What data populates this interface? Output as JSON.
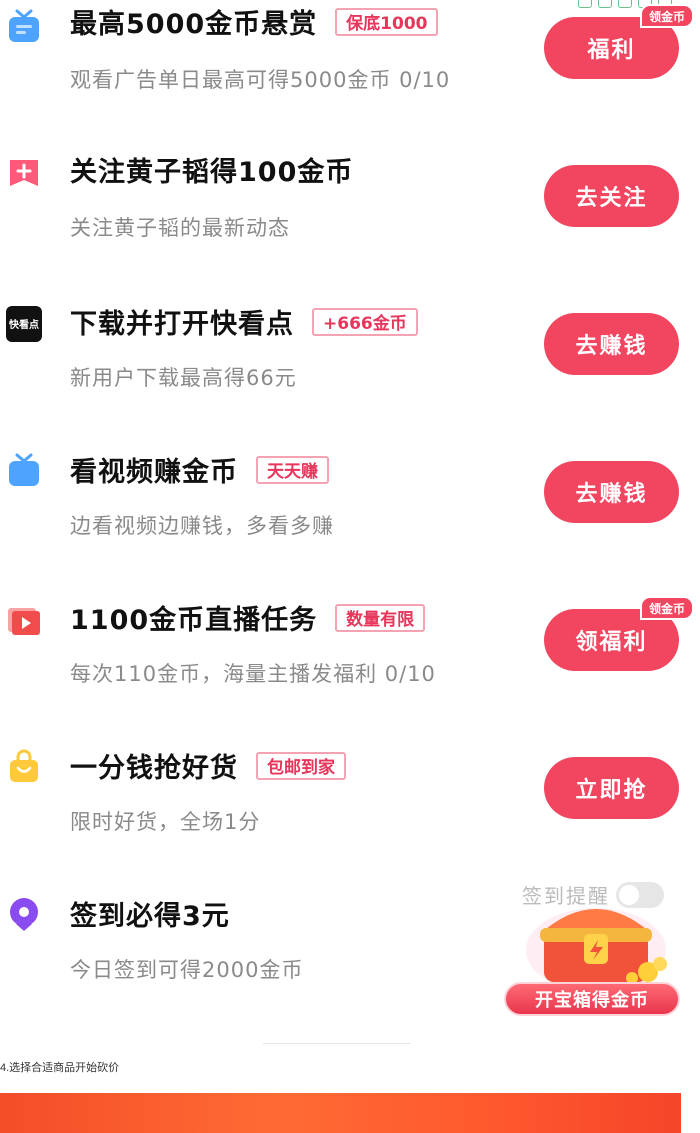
{
  "tasks": [
    {
      "title": "最高5000金币悬赏",
      "tag": "保底1000",
      "subtitle": "观看广告单日最高可得5000金币 0/10",
      "button": "福利",
      "badge": "领金币",
      "icon": "tv-icon",
      "icon_color": "#4da3ff"
    },
    {
      "title": "关注黄子韬得100金币",
      "tag": "",
      "subtitle": "关注黄子韬的最新动态",
      "button": "去关注",
      "badge": "",
      "icon": "plus-bookmark-icon",
      "icon_color": "#ff5a7a"
    },
    {
      "title": "下载并打开快看点",
      "tag": "+666金币",
      "subtitle": "新用户下载最高得66元",
      "button": "去赚钱",
      "badge": "",
      "icon": "kuaikandian-logo-icon",
      "icon_color": "#111111",
      "icon_text": "快看点"
    },
    {
      "title": "看视频赚金币",
      "tag": "天天赚",
      "subtitle": "边看视频边赚钱，多看多赚",
      "button": "去赚钱",
      "badge": "",
      "icon": "tv-icon",
      "icon_color": "#4da3ff"
    },
    {
      "title": "1100金币直播任务",
      "tag": "数量有限",
      "subtitle": "每次110金币，海量主播发福利 0/10",
      "button": "领福利",
      "badge": "领金币",
      "icon": "live-play-icon",
      "icon_color": "#f24b4b"
    },
    {
      "title": "一分钱抢好货",
      "tag": "包邮到家",
      "subtitle": "限时好货，全场1分",
      "button": "立即抢",
      "badge": "",
      "icon": "shopping-bag-icon",
      "icon_color": "#ffc93c"
    },
    {
      "title": "签到必得3元",
      "tag": "",
      "subtitle": "今日签到可得2000金币",
      "button": "",
      "badge": "",
      "icon": "location-pin-icon",
      "icon_color": "#8a4bf0"
    }
  ],
  "remind": {
    "label": "签到提醒"
  },
  "treasure": {
    "label": "开宝箱得金币"
  },
  "step_note": "4.选择合适商品开始砍价",
  "colors": {
    "accent": "#f2455f",
    "tag_text": "#e8355b",
    "bottom_bar": "#ff5a2e"
  }
}
